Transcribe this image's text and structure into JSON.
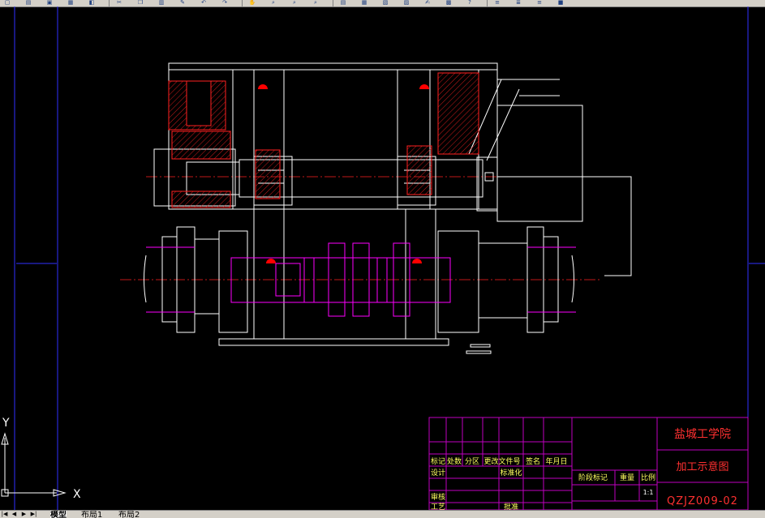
{
  "toolbar": {
    "icons": [
      "new-icon",
      "open-icon",
      "save-icon",
      "print-icon",
      "preview-icon",
      "cut-icon",
      "copy-icon",
      "paste-icon",
      "match-icon",
      "undo-icon",
      "redo-icon",
      "pan-icon",
      "zoom-icon",
      "zoom-window-icon",
      "zoom-prev-icon",
      "properties-icon",
      "design-center-icon",
      "tool-palette-icon",
      "sheet-set-icon",
      "markup-icon",
      "calc-icon",
      "help-icon",
      "layer-icon",
      "layer-state-icon",
      "layer-prev-icon",
      "color-icon"
    ]
  },
  "title_block": {
    "school": "盐城工学院",
    "drawing_title": "加工示意图",
    "drawing_number": "QZJZ009-02",
    "headers": {
      "mark": "标记",
      "count": "处数",
      "zone": "分区",
      "doc_number": "更改文件号",
      "signature": "签名",
      "date": "年月日",
      "design": "设计",
      "standardize": "标准化",
      "review": "审核",
      "craft": "工艺",
      "approve": "批准",
      "stage_mark": "阶段标记",
      "weight": "重量",
      "scale": "比例",
      "scale_value": "1:1"
    }
  },
  "ucs": {
    "x_label": "X",
    "y_label": "Y"
  },
  "tabs": {
    "model": "模型",
    "layout1": "布局1",
    "layout2": "布局2"
  },
  "colors": {
    "background": "#000000",
    "lines": "#ffffff",
    "hatch": "#ff2020",
    "centerline": "#ff2020",
    "magenta": "#ff00ff",
    "border": "#3030ff",
    "titleblock": "#c000c0",
    "title_text": "#ff3030"
  }
}
